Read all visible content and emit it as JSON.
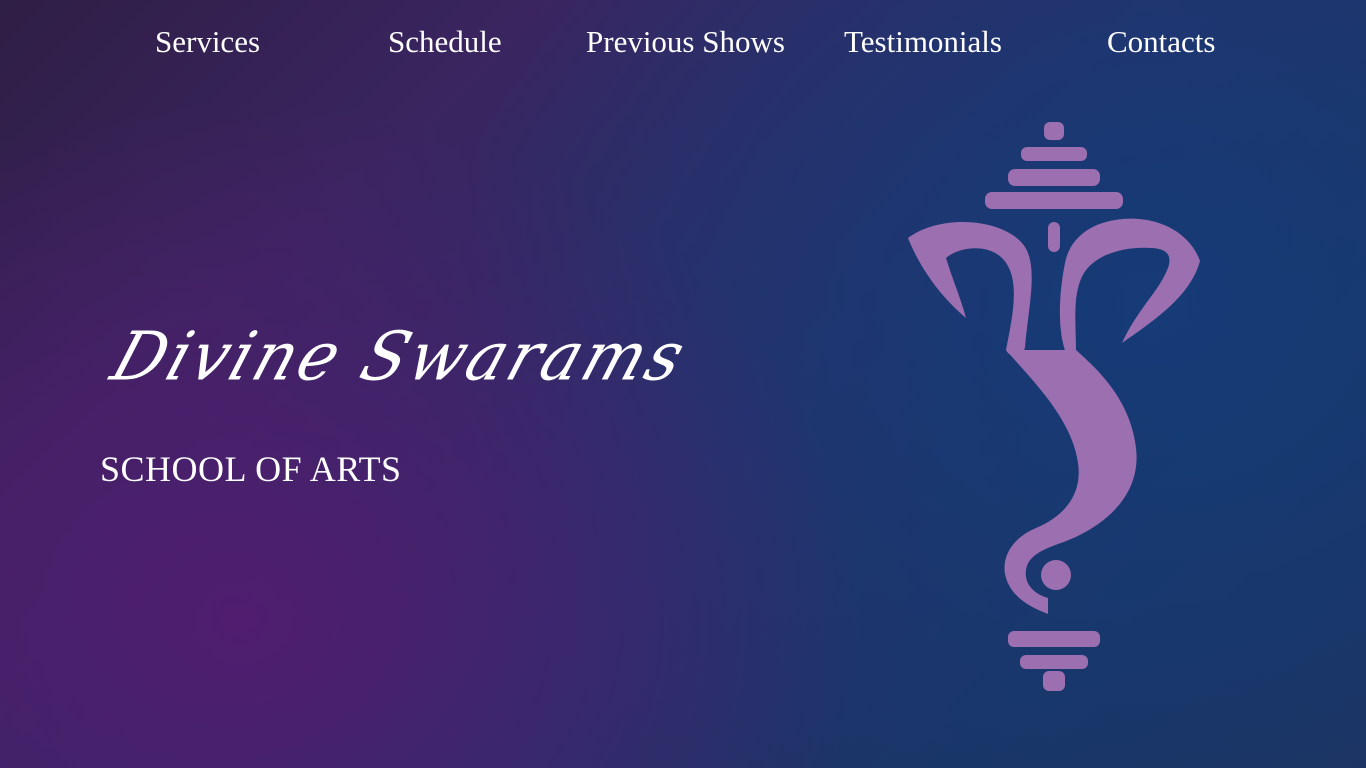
{
  "nav": {
    "items": [
      {
        "label": "Services"
      },
      {
        "label": "Schedule"
      },
      {
        "label": "Previous Shows"
      },
      {
        "label": "Testimonials"
      },
      {
        "label": "Contacts"
      }
    ]
  },
  "hero": {
    "title": "Divine Swarams",
    "subtitle": "SCHOOL OF ARTS",
    "logo_icon": "ganesha-logo-icon"
  },
  "colors": {
    "logo": "#9b6fb0",
    "text": "#ffffff",
    "bg_purple": "#4a1f6a",
    "bg_blue": "#173a70"
  }
}
